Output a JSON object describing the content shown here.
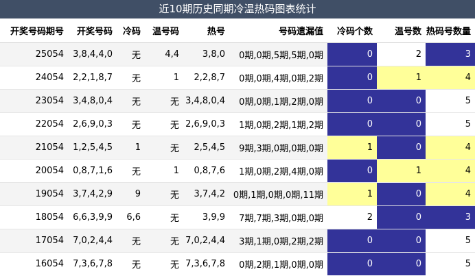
{
  "title": "近10期历史同期冷温热码图表统计",
  "headers": [
    "开奖号码期号",
    "开奖号码",
    "冷码",
    "温号码",
    "热号",
    "号码遗漏值",
    "冷码个数",
    "温号数",
    "热码号数量"
  ],
  "colors": {
    "blue": "#333399",
    "yellow": "#ffff99",
    "white": "#ffffff"
  },
  "rows": [
    {
      "period": "25054",
      "numbers": "3,8,4,4,0",
      "cold": "无",
      "warm": "4,4",
      "hot": "3,8,0",
      "miss": "0期,0期,5期,5期,0期",
      "cold_count": "0",
      "warm_count": "2",
      "hot_count": "3",
      "cold_color": "blue",
      "warm_color": "white",
      "hot_color": "blue"
    },
    {
      "period": "24054",
      "numbers": "2,2,1,8,7",
      "cold": "无",
      "warm": "1",
      "hot": "2,2,8,7",
      "miss": "0期,0期,4期,0期,2期",
      "cold_count": "0",
      "warm_count": "1",
      "hot_count": "4",
      "cold_color": "blue",
      "warm_color": "yellow",
      "hot_color": "yellow"
    },
    {
      "period": "23054",
      "numbers": "3,4,8,0,4",
      "cold": "无",
      "warm": "无",
      "hot": "3,4,8,0,4",
      "miss": "0期,0期,1期,2期,0期",
      "cold_count": "0",
      "warm_count": "0",
      "hot_count": "5",
      "cold_color": "blue",
      "warm_color": "blue",
      "hot_color": "white"
    },
    {
      "period": "22054",
      "numbers": "2,6,9,0,3",
      "cold": "无",
      "warm": "无",
      "hot": "2,6,9,0,3",
      "miss": "1期,0期,2期,1期,2期",
      "cold_count": "0",
      "warm_count": "0",
      "hot_count": "5",
      "cold_color": "blue",
      "warm_color": "blue",
      "hot_color": "white"
    },
    {
      "period": "21054",
      "numbers": "1,2,5,4,5",
      "cold": "1",
      "warm": "无",
      "hot": "2,5,4,5",
      "miss": "9期,3期,0期,0期,0期",
      "cold_count": "1",
      "warm_count": "0",
      "hot_count": "4",
      "cold_color": "yellow",
      "warm_color": "blue",
      "hot_color": "yellow"
    },
    {
      "period": "20054",
      "numbers": "0,8,7,1,6",
      "cold": "无",
      "warm": "1",
      "hot": "0,8,7,6",
      "miss": "1期,0期,2期,4期,0期",
      "cold_count": "0",
      "warm_count": "1",
      "hot_count": "4",
      "cold_color": "blue",
      "warm_color": "yellow",
      "hot_color": "yellow"
    },
    {
      "period": "19054",
      "numbers": "3,7,4,2,9",
      "cold": "9",
      "warm": "无",
      "hot": "3,7,4,2",
      "miss": "0期,1期,0期,0期,11期",
      "cold_count": "1",
      "warm_count": "0",
      "hot_count": "4",
      "cold_color": "yellow",
      "warm_color": "blue",
      "hot_color": "yellow"
    },
    {
      "period": "18054",
      "numbers": "6,6,3,9,9",
      "cold": "6,6",
      "warm": "无",
      "hot": "3,9,9",
      "miss": "7期,7期,3期,0期,0期",
      "cold_count": "2",
      "warm_count": "0",
      "hot_count": "3",
      "cold_color": "white",
      "warm_color": "blue",
      "hot_color": "blue"
    },
    {
      "period": "17054",
      "numbers": "7,0,2,4,4",
      "cold": "无",
      "warm": "无",
      "hot": "7,0,2,4,4",
      "miss": "3期,1期,0期,2期,2期",
      "cold_count": "0",
      "warm_count": "0",
      "hot_count": "5",
      "cold_color": "blue",
      "warm_color": "blue",
      "hot_color": "white"
    },
    {
      "period": "16054",
      "numbers": "7,3,6,7,8",
      "cold": "无",
      "warm": "无",
      "hot": "7,3,6,7,8",
      "miss": "0期,2期,1期,0期,0期",
      "cold_count": "0",
      "warm_count": "0",
      "hot_count": "5",
      "cold_color": "blue",
      "warm_color": "blue",
      "hot_color": "white"
    }
  ]
}
